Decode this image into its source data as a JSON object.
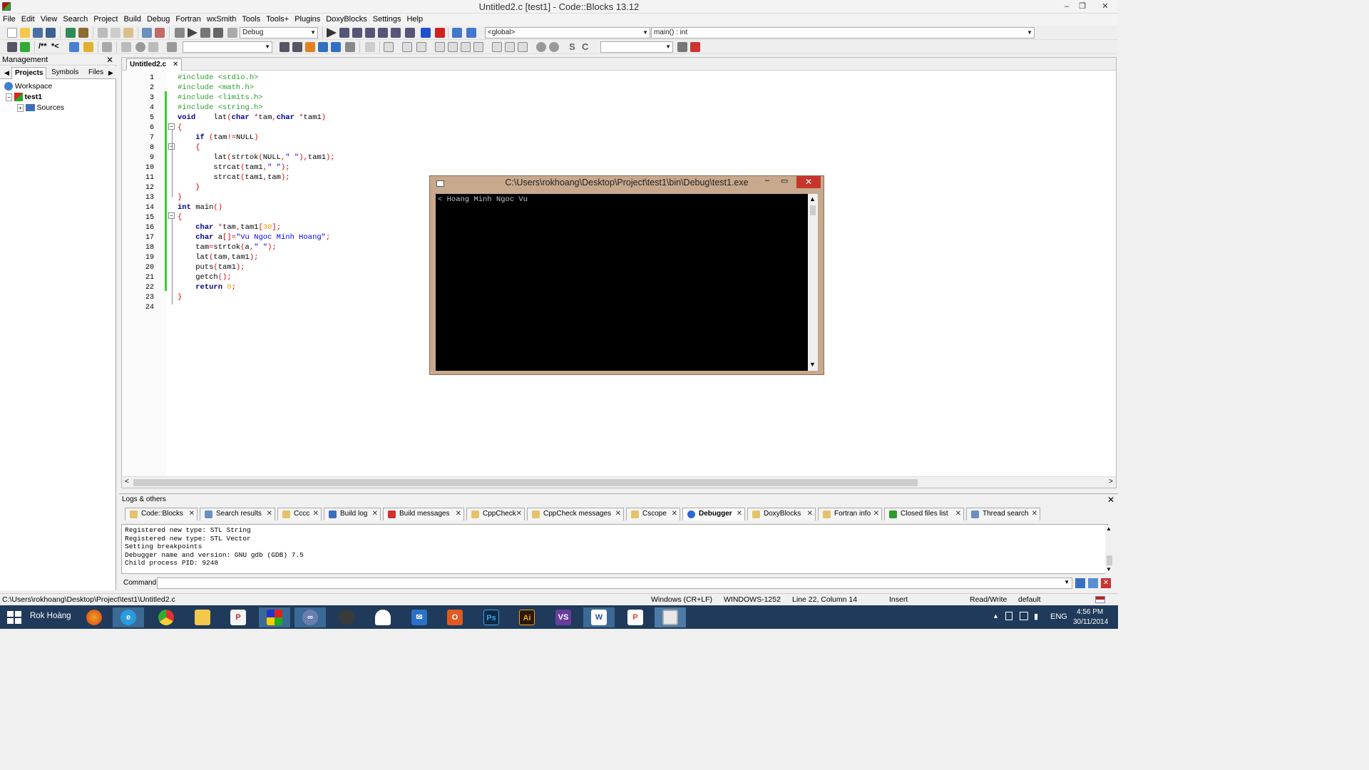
{
  "window": {
    "title": "Untitled2.c [test1] - Code::Blocks 13.12",
    "minimize": "–",
    "restore": "❐",
    "close": "✕"
  },
  "menu": [
    "File",
    "Edit",
    "View",
    "Search",
    "Project",
    "Build",
    "Debug",
    "Fortran",
    "wxSmith",
    "Tools",
    "Tools+",
    "Plugins",
    "DoxyBlocks",
    "Settings",
    "Help"
  ],
  "toolbar": {
    "build_target": "Debug",
    "scope": "<global>",
    "function": "main() : int",
    "search": "",
    "toolbar3_combo": ""
  },
  "management": {
    "title": "Management",
    "tabs": [
      "Projects",
      "Symbols",
      "Files"
    ],
    "tree": {
      "workspace": "Workspace",
      "project": "test1",
      "folder": "Sources"
    }
  },
  "editor": {
    "tab_label": "Untitled2.c",
    "lines": [
      "1",
      "2",
      "3",
      "4",
      "5",
      "6",
      "7",
      "8",
      "9",
      "10",
      "11",
      "12",
      "13",
      "14",
      "15",
      "16",
      "17",
      "18",
      "19",
      "20",
      "21",
      "22",
      "23",
      "24"
    ]
  },
  "console": {
    "title": "C:\\Users\\rokhoang\\Desktop\\Project\\test1\\bin\\Debug\\test1.exe",
    "output": "Hoang Minh Ngoc Vu"
  },
  "logs": {
    "title": "Logs & others",
    "tabs": [
      "Code::Blocks",
      "Search results",
      "Cccc",
      "Build log",
      "Build messages",
      "CppCheck",
      "CppCheck messages",
      "Cscope",
      "Debugger",
      "DoxyBlocks",
      "Fortran info",
      "Closed files list",
      "Thread search"
    ],
    "active_tab": "Debugger",
    "text": "Registered new type: STL String\nRegistered new type: STL Vector\nSetting breakpoints\nDebugger name and version: GNU gdb (GDB) 7.5\nChild process PID: 9248",
    "command_label": "Command:"
  },
  "status": {
    "path": "C:\\Users\\rokhoang\\Desktop\\Project\\test1\\Untitled2.c",
    "eol": "Windows (CR+LF)",
    "encoding": "WINDOWS-1252",
    "position": "Line 22, Column 14",
    "mode": "Insert",
    "access": "Read/Write",
    "profile": "default"
  },
  "taskbar": {
    "user": "Rok Hoàng",
    "language": "ENG",
    "time": "4:56 PM",
    "date": "30/11/2014",
    "apps": [
      "firefox",
      "internet-explorer",
      "chrome",
      "file-explorer",
      "powerpoint-viewer",
      "codeblocks",
      "visual-studio-infinity",
      "github",
      "onedrive",
      "mail",
      "office",
      "photoshop",
      "illustrator",
      "visual-studio",
      "word",
      "powerpoint",
      "console"
    ]
  },
  "colors": {
    "accent": "#2ed42e",
    "console_frame": "#c8a98d",
    "close_red": "#c7362c",
    "taskbar": "#1f3a5a"
  }
}
